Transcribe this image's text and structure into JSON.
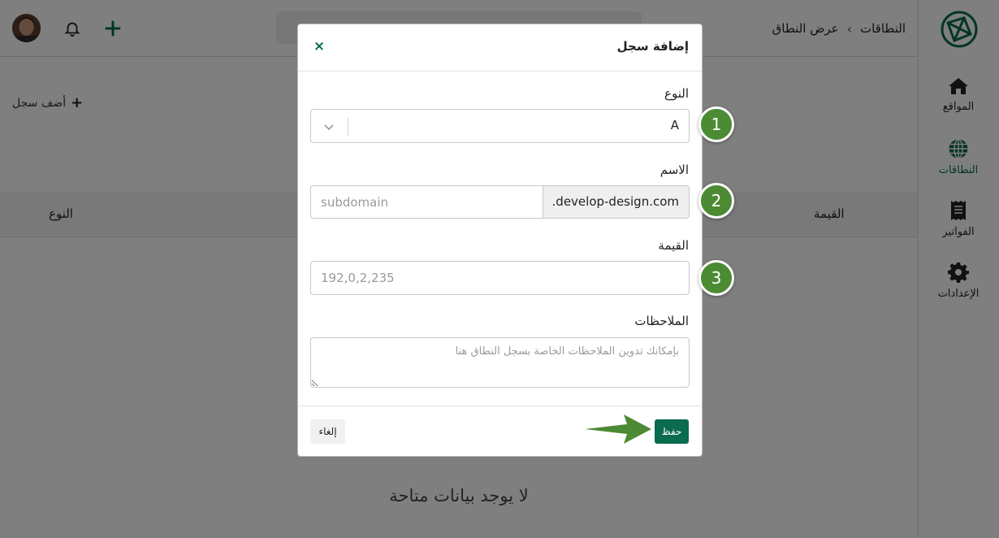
{
  "breadcrumb": {
    "root": "النطاقات",
    "current": "عرض النطاق"
  },
  "sidebar": {
    "items": [
      {
        "label": "المواقع",
        "icon": "home-icon"
      },
      {
        "label": "النطاقات",
        "icon": "globe-icon",
        "active": true
      },
      {
        "label": "الفواتير",
        "icon": "receipt-icon"
      },
      {
        "label": "الإعدادات",
        "icon": "gear-icon"
      }
    ]
  },
  "main": {
    "add_record_label": "أضف سجل",
    "columns": {
      "type": "النوع",
      "value": "القيمة"
    },
    "empty_message": "لا يوجد بيانات متاحة"
  },
  "modal": {
    "title": "إضافة سجل",
    "close_glyph": "×",
    "type_label": "النوع",
    "type_value": "A",
    "name_label": "الاسم",
    "name_placeholder": "subdomain",
    "name_suffix": ".develop-design.com",
    "value_label": "القيمة",
    "value_placeholder": "192,0,2,235",
    "notes_label": "الملاحظات",
    "notes_placeholder": "بإمكانك تدوين الملاحظات الخاصة بسجل النطاق هنا",
    "save_label": "حفظ",
    "cancel_label": "إلغاء"
  },
  "annotations": {
    "step1": "1",
    "step2": "2",
    "step3": "3"
  },
  "colors": {
    "brand": "#0b6b4f",
    "annotation_green": "#4c8a34",
    "overlay": "rgba(0,0,0,0.5)"
  }
}
